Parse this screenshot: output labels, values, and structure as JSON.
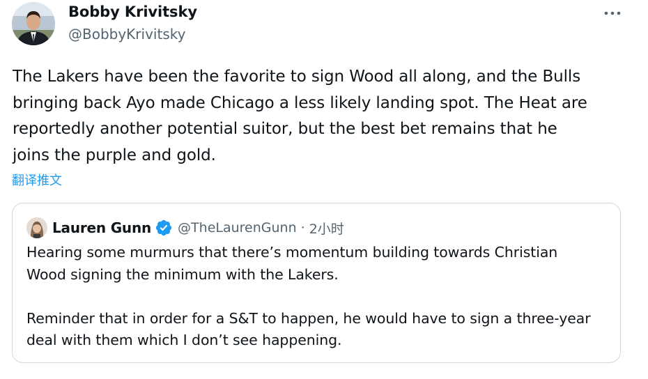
{
  "author": {
    "name": "Bobby Krivitsky",
    "handle": "@BobbyKrivitsky",
    "avatar_icon": "user-avatar"
  },
  "more_icon": "more-horizontal-icon",
  "tweet": {
    "lines": [
      "The Lakers have been the favorite to sign Wood all along, and the Bulls",
      "bringing back Ayo made Chicago a less likely landing spot. The Heat are",
      "reportedly another potential suitor, but the best bet remains that he",
      "joins the purple and gold."
    ],
    "translate_label": "翻译推文"
  },
  "quote": {
    "name": "Lauren Gunn",
    "verified_icon": "verified-badge-icon",
    "handle": "@TheLaurenGunn",
    "separator": "·",
    "time": "2小时",
    "paragraph1": [
      "Hearing some murmurs that there’s momentum building towards Christian",
      "Wood signing the minimum with the Lakers."
    ],
    "paragraph2": [
      "Reminder that in order for a S&T to happen, he would have to sign a three-year",
      "deal with them which I don’t see happening."
    ]
  },
  "colors": {
    "text": "#0f1419",
    "secondary": "#536471",
    "link": "#1d9bf0",
    "border": "#cfd9de",
    "verified": "#1d9bf0"
  }
}
